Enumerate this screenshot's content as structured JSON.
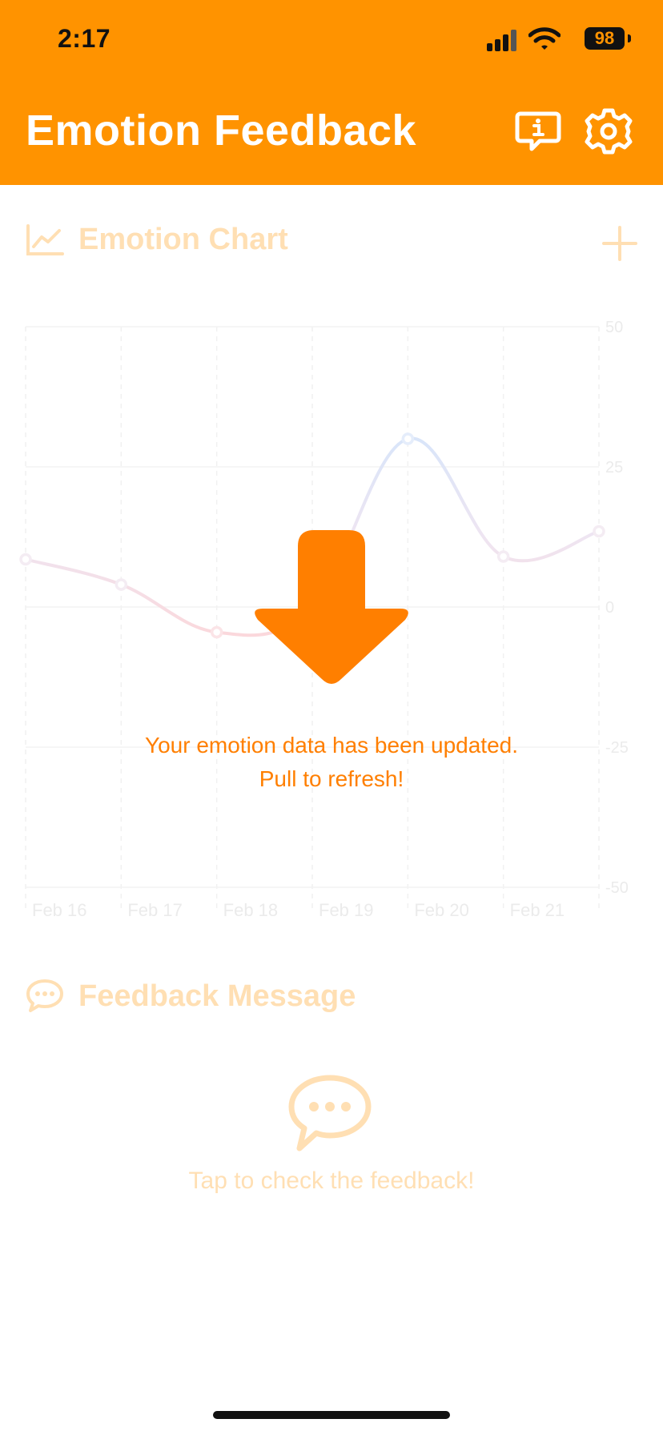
{
  "status_bar": {
    "time": "2:17",
    "battery": "98"
  },
  "header": {
    "title": "Emotion Feedback"
  },
  "chart_section": {
    "title": "Emotion Chart"
  },
  "chart_data": {
    "type": "line",
    "categories": [
      "Feb 16",
      "Feb 17",
      "Feb 18",
      "Feb 19",
      "Feb 20",
      "Feb 21",
      ""
    ],
    "series": [
      {
        "values": [
          8.5,
          4,
          -4.5,
          0,
          30,
          9,
          13.5
        ]
      }
    ],
    "y_ticks": [
      "50",
      "25",
      "0",
      "-25",
      "-50"
    ],
    "ylim": [
      -50,
      50
    ],
    "grid": true,
    "colors": {
      "positive": "#A7C4F0",
      "negative": "#F2A6AE",
      "neutral": "#D9BFD6"
    }
  },
  "feedback_section": {
    "title": "Feedback Message",
    "prompt": "Tap to check the feedback!"
  },
  "refresh_overlay": {
    "line1": "Your emotion data has been updated.",
    "line2": "Pull to refresh!"
  },
  "icons": {
    "header_info": "info-bubble-icon",
    "header_settings": "gear-icon",
    "chart": "line-chart-icon",
    "add": "plus-icon",
    "feedback": "chat-bubble-icon",
    "empty_feedback": "chat-dots-icon",
    "refresh": "down-arrow-icon"
  },
  "colors": {
    "accent": "#FF9300",
    "arrow": "#FF7F00"
  }
}
